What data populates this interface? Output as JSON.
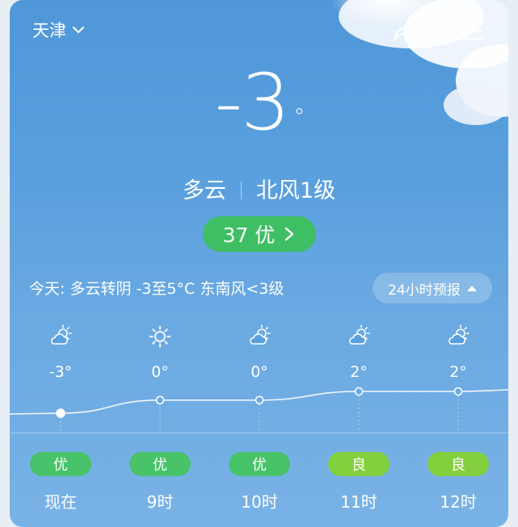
{
  "header": {
    "city": "天津"
  },
  "current": {
    "temp": "-3",
    "deg": "°",
    "condition": "多云",
    "wind": "北风1级"
  },
  "aqi": {
    "label": "37 优"
  },
  "today": {
    "summary": "今天: 多云转阴  -3至5°C  东南风<3级"
  },
  "forecast_button": {
    "label": "24小时预报"
  },
  "colors": {
    "aqi_good": "#3fbf63",
    "aqi_moderate": "#84cf3e",
    "sky": "#5aa0de"
  },
  "hourly": [
    {
      "icon": "partly-cloudy-icon",
      "temp": "-3°",
      "aqi": "优",
      "aqi_level": "good",
      "time": "现在"
    },
    {
      "icon": "sunny-icon",
      "temp": "0°",
      "aqi": "优",
      "aqi_level": "good",
      "time": "9时"
    },
    {
      "icon": "partly-cloudy-icon",
      "temp": "0°",
      "aqi": "优",
      "aqi_level": "good",
      "time": "10时"
    },
    {
      "icon": "partly-cloudy-icon",
      "temp": "2°",
      "aqi": "良",
      "aqi_level": "moderate",
      "time": "11时"
    },
    {
      "icon": "partly-cloudy-icon",
      "temp": "2°",
      "aqi": "良",
      "aqi_level": "moderate",
      "time": "12时"
    }
  ],
  "chart_data": {
    "type": "line",
    "categories": [
      "现在",
      "9时",
      "10时",
      "11时",
      "12时"
    ],
    "values": [
      -3,
      0,
      0,
      2,
      2
    ],
    "title": "",
    "xlabel": "",
    "ylabel": ""
  }
}
